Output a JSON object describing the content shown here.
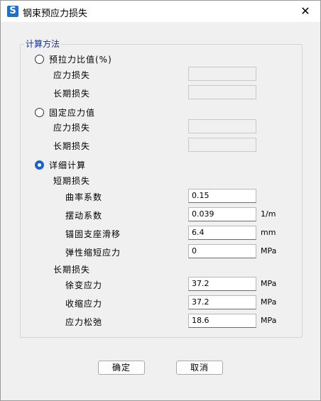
{
  "window": {
    "title": "钢束预应力损失",
    "app_icon_letter": "S",
    "close_glyph": "✕"
  },
  "group": {
    "title": "计算方法"
  },
  "option_prestress_ratio": {
    "label": "预拉力比值(%)",
    "stress_loss_label": "应力损失",
    "stress_loss_value": "",
    "long_term_label": "长期损失",
    "long_term_value": "",
    "selected": false
  },
  "option_fixed": {
    "label": "固定应力值",
    "stress_loss_label": "应力损失",
    "stress_loss_value": "",
    "long_term_label": "长期损失",
    "long_term_value": "",
    "selected": false
  },
  "option_detailed": {
    "label": "详细计算",
    "selected": true,
    "short_term": {
      "heading": "短期损失",
      "curvature_label": "曲率系数",
      "curvature_value": "0.15",
      "wobble_label": "摆动系数",
      "wobble_value": "0.039",
      "wobble_unit": "1/m",
      "anchor_slip_label": "锚固支座滑移",
      "anchor_slip_value": "6.4",
      "anchor_slip_unit": "mm",
      "elastic_label": "弹性缩短应力",
      "elastic_value": "0",
      "elastic_unit": "MPa"
    },
    "long_term": {
      "heading": "长期损失",
      "creep_label": "徐变应力",
      "creep_value": "37.2",
      "creep_unit": "MPa",
      "shrinkage_label": "收缩应力",
      "shrinkage_value": "37.2",
      "shrinkage_unit": "MPa",
      "relaxation_label": "应力松弛",
      "relaxation_value": "18.6",
      "relaxation_unit": "MPa"
    }
  },
  "buttons": {
    "ok": "确定",
    "cancel": "取消"
  }
}
